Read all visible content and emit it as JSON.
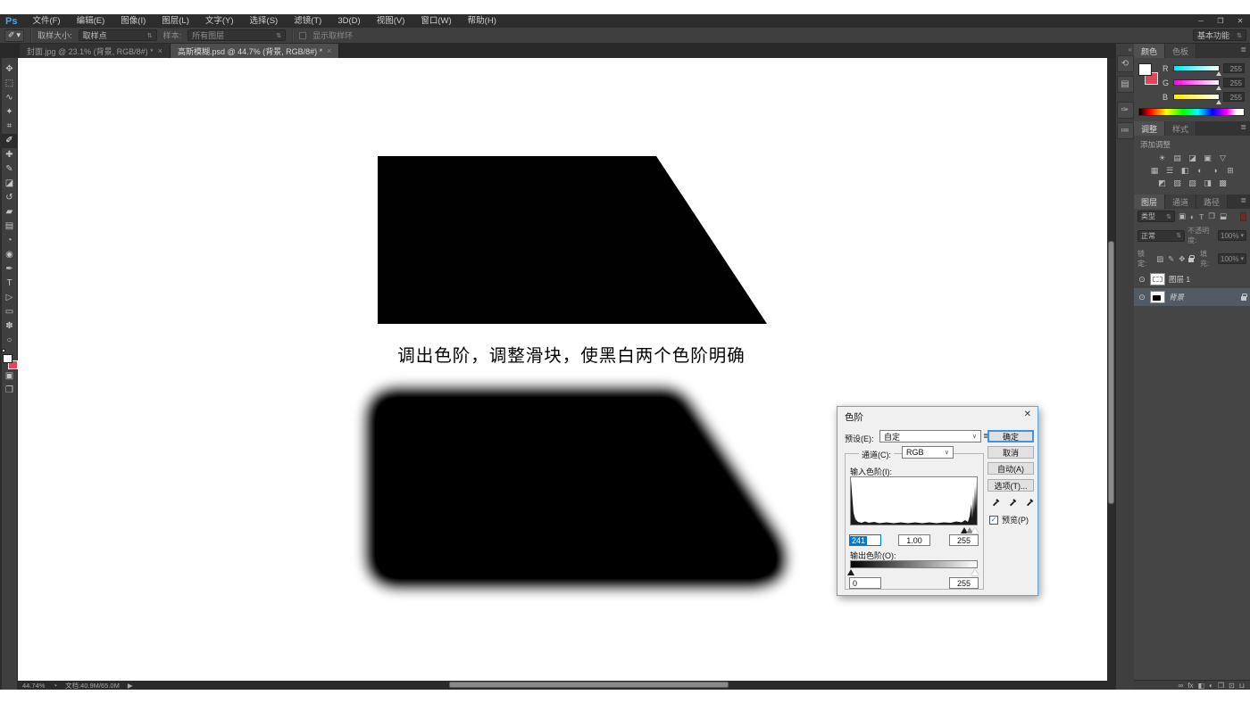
{
  "window": {
    "controls": {
      "minimize": "─",
      "restore": "❐",
      "close": "✕"
    }
  },
  "menu": {
    "logo": "Ps",
    "items": [
      "文件(F)",
      "编辑(E)",
      "图像(I)",
      "图层(L)",
      "文字(Y)",
      "选择(S)",
      "滤镜(T)",
      "3D(D)",
      "视图(V)",
      "窗口(W)",
      "帮助(H)"
    ]
  },
  "options": {
    "tool_icon": "✐",
    "tool_arrow": "▾",
    "sample_size_label": "取样大小:",
    "sample_size_value": "取样点",
    "sample_label": "样本:",
    "sample_value": "所有图层",
    "show_ring_label": "显示取样环",
    "workspace": "基本功能"
  },
  "ui": {
    "combo_arrow": "⇅",
    "select_arrow": "∨",
    "small_arrow": "▾",
    "collapse": "«",
    "panel_menu": "≣"
  },
  "tabs": [
    {
      "label": "封面.jpg @ 23.1% (背景, RGB/8#) *",
      "close": "×"
    },
    {
      "label": "高斯模糊.psd @ 44.7% (背景, RGB/8#) *",
      "close": "×"
    }
  ],
  "tools": [
    {
      "name": "move-tool",
      "glyph": "✥"
    },
    {
      "name": "marquee-tool",
      "glyph": "⬚"
    },
    {
      "name": "lasso-tool",
      "glyph": "∿"
    },
    {
      "name": "quick-selection-tool",
      "glyph": "✦"
    },
    {
      "name": "crop-tool",
      "glyph": "⌗"
    },
    {
      "name": "eyedropper-tool",
      "glyph": "✐"
    },
    {
      "name": "spot-healing-tool",
      "glyph": "✚"
    },
    {
      "name": "brush-tool",
      "glyph": "✎"
    },
    {
      "name": "clone-stamp-tool",
      "glyph": "◪"
    },
    {
      "name": "history-brush-tool",
      "glyph": "↺"
    },
    {
      "name": "eraser-tool",
      "glyph": "▰"
    },
    {
      "name": "gradient-tool",
      "glyph": "▤"
    },
    {
      "name": "blur-tool",
      "glyph": "◔"
    },
    {
      "name": "dodge-tool",
      "glyph": "◉"
    },
    {
      "name": "pen-tool",
      "glyph": "✒"
    },
    {
      "name": "type-tool",
      "glyph": "T"
    },
    {
      "name": "path-selection-tool",
      "glyph": "▷"
    },
    {
      "name": "shape-tool",
      "glyph": "▭"
    },
    {
      "name": "hand-tool",
      "glyph": "✽"
    },
    {
      "name": "zoom-tool",
      "glyph": "○"
    }
  ],
  "tool_extras": {
    "quick_mask": "▣",
    "screen_mode": "❐"
  },
  "canvas": {
    "caption": "调出色阶，调整滑块，使黑白两个色阶明确"
  },
  "status": {
    "zoom": "44.74%",
    "icon": "◔",
    "doc": "文档:40.9M/65.0M",
    "flyout": "▶"
  },
  "dock": {
    "items": [
      {
        "name": "history-panel-icon",
        "glyph": "⟲"
      },
      {
        "name": "properties-panel-icon",
        "glyph": "▤"
      },
      {
        "name": "info-panel-icon",
        "glyph": "✑"
      },
      {
        "name": "adjust-sliders-panel-icon",
        "glyph": "≔"
      }
    ]
  },
  "panels": {
    "color": {
      "tab_color": "颜色",
      "tab_swatches": "色板",
      "sliders": [
        {
          "label": "R",
          "value": "255"
        },
        {
          "label": "G",
          "value": "255"
        },
        {
          "label": "B",
          "value": "255"
        }
      ]
    },
    "adjustments": {
      "tab_adjust": "调整",
      "tab_styles": "样式",
      "add_label": "添加调整",
      "row1": [
        {
          "name": "brightness-contrast-icon",
          "glyph": "☀"
        },
        {
          "name": "levels-icon",
          "glyph": "▤"
        },
        {
          "name": "curves-icon",
          "glyph": "◪"
        },
        {
          "name": "exposure-icon",
          "glyph": "▣"
        },
        {
          "name": "vibrance-icon",
          "glyph": "▽"
        }
      ],
      "row2": [
        {
          "name": "hue-saturation-icon",
          "glyph": "▦"
        },
        {
          "name": "color-balance-icon",
          "glyph": "☰"
        },
        {
          "name": "black-white-icon",
          "glyph": "◧"
        },
        {
          "name": "photo-filter-icon",
          "glyph": "◐"
        },
        {
          "name": "channel-mixer-icon",
          "glyph": "◑"
        },
        {
          "name": "color-lookup-icon",
          "glyph": "⊞"
        }
      ],
      "row3": [
        {
          "name": "invert-icon",
          "glyph": "◩"
        },
        {
          "name": "posterize-icon",
          "glyph": "▧"
        },
        {
          "name": "threshold-icon",
          "glyph": "▨"
        },
        {
          "name": "selective-color-icon",
          "glyph": "◨"
        },
        {
          "name": "gradient-map-icon",
          "glyph": "▩"
        }
      ]
    },
    "layers": {
      "tab_layers": "图层",
      "tab_channels": "通道",
      "tab_paths": "路径",
      "filter_search": "🔍",
      "filter_label": "类型",
      "filter_icons": [
        {
          "name": "filter-pixel-icon",
          "glyph": "▣"
        },
        {
          "name": "filter-adjustment-icon",
          "glyph": "◐"
        },
        {
          "name": "filter-type-icon",
          "glyph": "T"
        },
        {
          "name": "filter-shape-icon",
          "glyph": "❒"
        },
        {
          "name": "filter-smartobject-icon",
          "glyph": "⬓"
        }
      ],
      "blend_mode": "正常",
      "opacity_label": "不透明度:",
      "opacity": "100%",
      "lock_label": "锁定:",
      "lock_icons": [
        {
          "name": "lock-transparency-icon",
          "glyph": "▨"
        },
        {
          "name": "lock-pixels-icon",
          "glyph": "✎"
        },
        {
          "name": "lock-position-icon",
          "glyph": "✥"
        }
      ],
      "fill_label": "填充:",
      "fill": "100%",
      "eye": "⊙",
      "layers": [
        {
          "name": "图层 1"
        },
        {
          "name": "背景"
        }
      ],
      "footer": [
        {
          "name": "link-layers-icon",
          "glyph": "∞"
        },
        {
          "name": "layer-style-icon",
          "glyph": "fx"
        },
        {
          "name": "layer-mask-icon",
          "glyph": "◧"
        },
        {
          "name": "new-adjustment-icon",
          "glyph": "◐"
        },
        {
          "name": "new-group-icon",
          "glyph": "❒"
        },
        {
          "name": "new-layer-icon",
          "glyph": "⊡"
        },
        {
          "name": "delete-layer-icon",
          "glyph": "⊔"
        }
      ]
    }
  },
  "dialog": {
    "title": "色阶",
    "close": "✕",
    "preset_label": "预设(E):",
    "preset_value": "自定",
    "preset_menu_icon": "≣",
    "channel_label": "通道(C):",
    "channel_value": "RGB",
    "input_label": "输入色阶(I):",
    "input_low": "241",
    "input_gamma": "1.00",
    "input_high": "255",
    "output_label": "输出色阶(O):",
    "output_low": "0",
    "output_high": "255",
    "ok": "确定",
    "cancel": "取消",
    "auto": "自动(A)",
    "options": "选项(T)...",
    "preview_check": "✓",
    "preview_label": "预览(P)"
  },
  "colors": {
    "accent_blue": "#0078d7",
    "bg_swatch_red": "#e0475f",
    "ok_border": "#3f93e0"
  }
}
